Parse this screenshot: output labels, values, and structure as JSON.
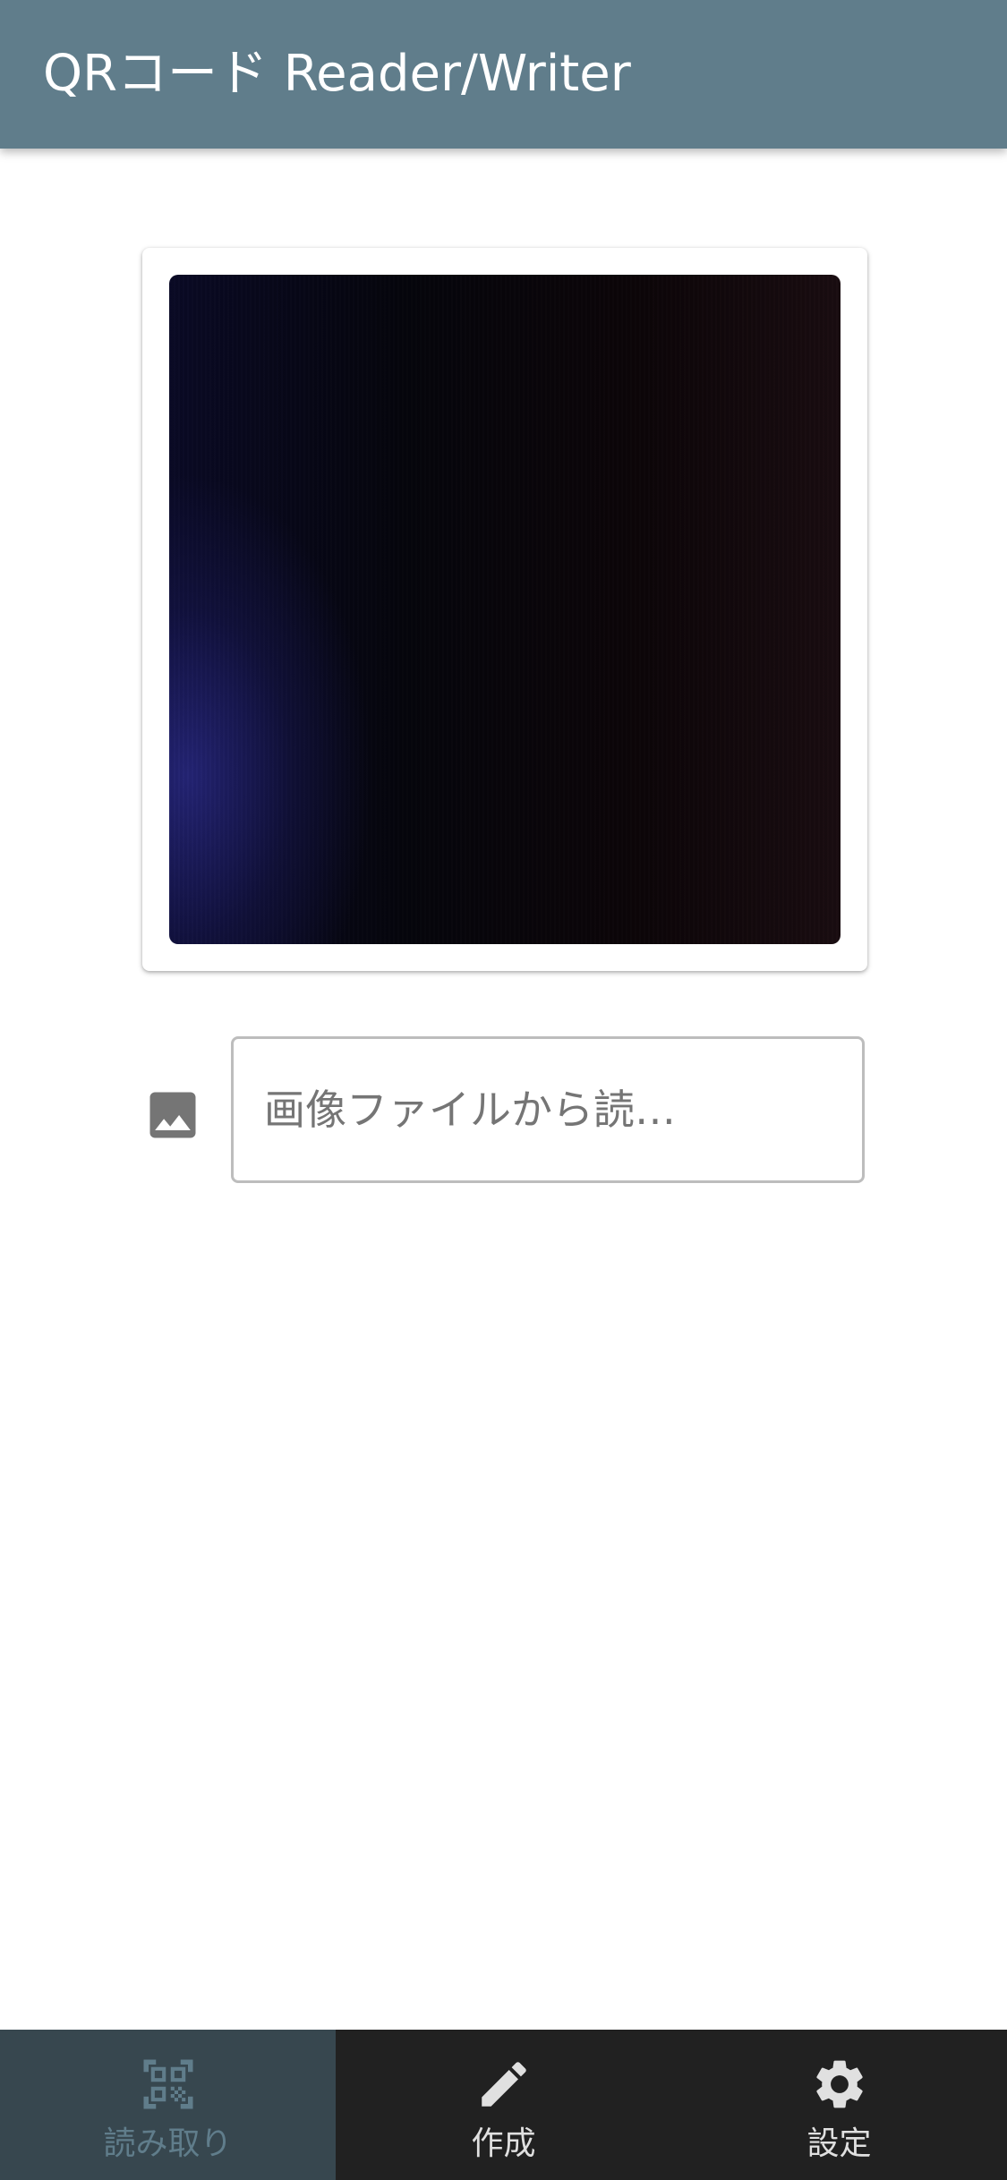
{
  "app_bar": {
    "title": "QRコード Reader/Writer",
    "background_color": "#607d8b"
  },
  "scanner": {
    "file_input": {
      "placeholder": "画像ファイルから読…",
      "icon": "image-icon"
    }
  },
  "bottom_nav": {
    "items": [
      {
        "label": "読み取り",
        "icon": "qr-code-scanner-icon",
        "active": true
      },
      {
        "label": "作成",
        "icon": "pencil-icon",
        "active": false
      },
      {
        "label": "設定",
        "icon": "gear-icon",
        "active": false
      }
    ],
    "active_color": "#607d8b",
    "background_color": "#212121"
  }
}
